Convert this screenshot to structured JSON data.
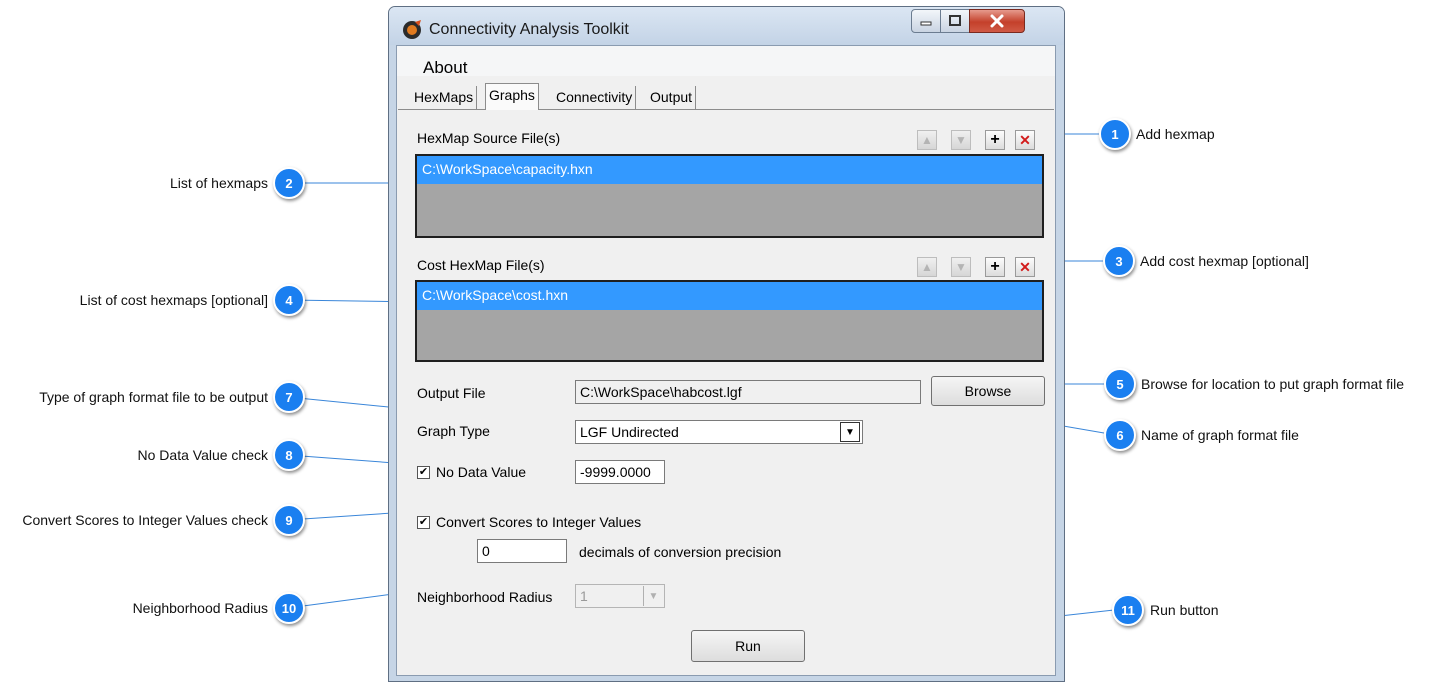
{
  "window": {
    "title": "Connectivity Analysis Toolkit",
    "menu": [
      "About"
    ],
    "tabs": [
      "HexMaps",
      "Graphs",
      "Connectivity",
      "Output"
    ],
    "active_tab": "Graphs"
  },
  "graphs": {
    "hexmap_source_label": "HexMap Source File(s)",
    "hexmap_sources": [
      "C:\\WorkSpace\\capacity.hxn"
    ],
    "cost_hexmap_label": "Cost HexMap File(s)",
    "cost_hexmaps": [
      "C:\\WorkSpace\\cost.hxn"
    ],
    "output_file_label": "Output File",
    "output_file_value": "C:\\WorkSpace\\habcost.lgf",
    "browse_label": "Browse",
    "graph_type_label": "Graph Type",
    "graph_type_value": "LGF Undirected",
    "no_data_label": "No Data Value",
    "no_data_checked": true,
    "no_data_value": "-9999.0000",
    "convert_label": "Convert Scores to Integer Values",
    "convert_checked": true,
    "decimals_value": "0",
    "decimals_label": "decimals of conversion precision",
    "radius_label": "Neighborhood Radius",
    "radius_value": "1",
    "run_label": "Run"
  },
  "icons": {
    "up": "arrow-up-icon",
    "down": "arrow-down-icon",
    "add": "plus-icon",
    "delete": "x-icon",
    "app": "app-logo-icon"
  },
  "callouts": [
    {
      "num": "1",
      "text": "Add hexmap"
    },
    {
      "num": "2",
      "text": "List of hexmaps"
    },
    {
      "num": "3",
      "text": "Add cost hexmap [optional]"
    },
    {
      "num": "4",
      "text": "List of cost hexmaps [optional]"
    },
    {
      "num": "5",
      "text": "Browse for location to put graph format file"
    },
    {
      "num": "6",
      "text": "Name of graph format file"
    },
    {
      "num": "7",
      "text": "Type of graph format file to be output"
    },
    {
      "num": "8",
      "text": "No Data Value check"
    },
    {
      "num": "9",
      "text": "Convert Scores to Integer Values check"
    },
    {
      "num": "10",
      "text": "Neighborhood Radius"
    },
    {
      "num": "11",
      "text": "Run button"
    }
  ],
  "colors": {
    "callout_blue": "#1a7ff0",
    "selection_blue": "#3399ff",
    "list_bg": "#a5a5a5",
    "close_red": "#c4402b"
  }
}
